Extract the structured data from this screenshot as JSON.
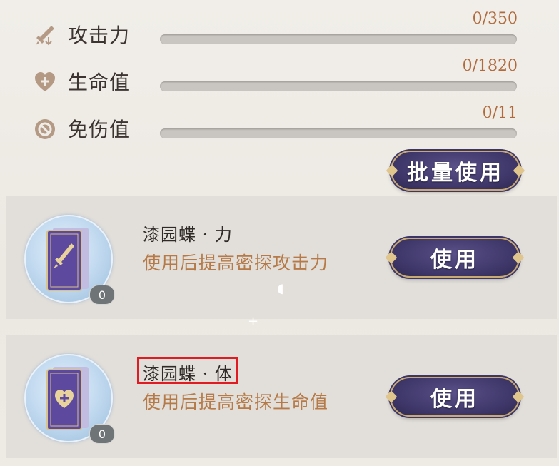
{
  "stats": [
    {
      "icon": "sword-icon",
      "label": "攻击力",
      "value": "0/350",
      "fill": 0
    },
    {
      "icon": "heart-plus-icon",
      "label": "生命值",
      "value": "0/1820",
      "fill": 0
    },
    {
      "icon": "shield-icon",
      "label": "免伤值",
      "value": "0/11",
      "fill": 0
    }
  ],
  "batch_button": "批量使用",
  "items": [
    {
      "icon": "sword-card-icon",
      "name": "漆园蝶 · 力",
      "desc": "使用后提高密探攻击力",
      "count": "0",
      "button": "使用"
    },
    {
      "icon": "heart-card-icon",
      "name": "漆园蝶 · 体",
      "desc": "使用后提高密探生命值",
      "count": "0",
      "button": "使用"
    }
  ],
  "colors": {
    "accent": "#b06a3c",
    "button": "#3c3566",
    "highlight": "#e01b22"
  }
}
